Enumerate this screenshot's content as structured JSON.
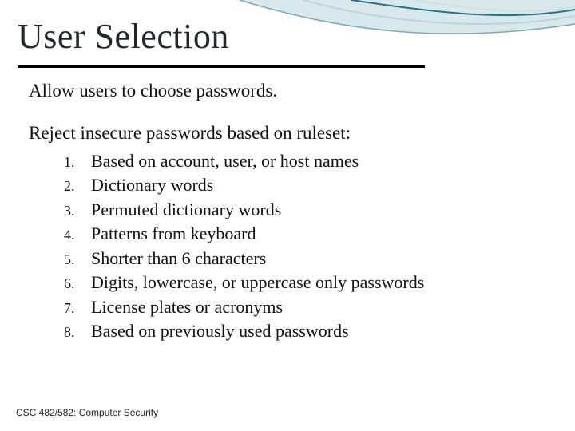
{
  "title": "User Selection",
  "paragraphs": [
    "Allow users to choose passwords.",
    "Reject insecure passwords based on ruleset:"
  ],
  "rules": [
    {
      "num": "1.",
      "text": "Based on account, user, or host names"
    },
    {
      "num": "2.",
      "text": "Dictionary words"
    },
    {
      "num": "3.",
      "text": "Permuted dictionary words"
    },
    {
      "num": "4.",
      "text": "Patterns from keyboard"
    },
    {
      "num": "5.",
      "text": "Shorter than 6 characters"
    },
    {
      "num": "6.",
      "text": "Digits, lowercase, or uppercase only passwords"
    },
    {
      "num": "7.",
      "text": "License plates or acronyms"
    },
    {
      "num": "8.",
      "text": "Based on previously used passwords"
    }
  ],
  "footer": "CSC 482/582: Computer Security"
}
